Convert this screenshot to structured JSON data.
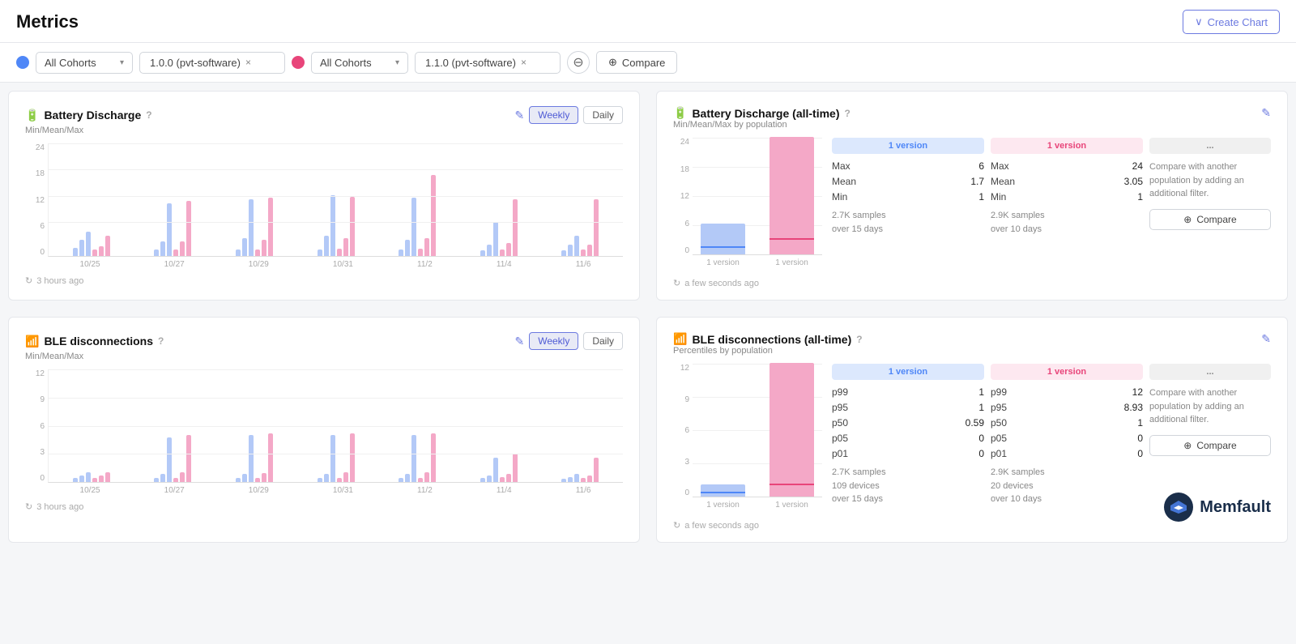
{
  "header": {
    "title": "Metrics",
    "create_chart_label": "Create Chart",
    "create_chart_arrow": "∨"
  },
  "filter_bar": {
    "cohort1_dot": "blue",
    "cohort1_label": "All Cohorts",
    "cohort1_arrow": "▾",
    "version1_label": "1.0.0 (pvt-software)",
    "version1_close": "×",
    "cohort2_label": "All Cohorts",
    "cohort2_arrow": "▾",
    "version2_label": "1.1.0 (pvt-software)",
    "version2_close": "×",
    "remove_icon": "−",
    "compare_icon": "⊕",
    "compare_label": "Compare"
  },
  "battery_discharge": {
    "icon": "🔋",
    "title": "Battery Discharge",
    "subtitle": "Min/Mean/Max",
    "help": "?",
    "weekly_label": "Weekly",
    "daily_label": "Daily",
    "timestamp": "3 hours ago",
    "y_labels": [
      "24",
      "18",
      "12",
      "6",
      "0"
    ],
    "x_labels": [
      "10/25",
      "10/27",
      "10/29",
      "10/31",
      "11/2",
      "11/4",
      "11/6"
    ]
  },
  "battery_discharge_alltime": {
    "icon": "🔋",
    "title": "Battery Discharge (all-time)",
    "subtitle": "Min/Mean/Max by population",
    "help": "?",
    "timestamp": "a few seconds ago",
    "version1_header": "1 version",
    "version2_header": "1 version",
    "compare_header": "...",
    "stats1": {
      "max_label": "Max",
      "max_val": "6",
      "mean_label": "Mean",
      "mean_val": "1.7",
      "min_label": "Min",
      "min_val": "1",
      "samples": "2.7K samples",
      "over": "over 15 days"
    },
    "stats2": {
      "max_label": "Max",
      "max_val": "24",
      "mean_label": "Mean",
      "mean_val": "3.05",
      "min_label": "Min",
      "min_val": "1",
      "samples": "2.9K samples",
      "over": "over 10 days"
    },
    "compare_desc": "Compare with another population by adding an additional filter.",
    "compare_btn": "Compare",
    "x_labels": [
      "1 version",
      "1 version"
    ],
    "y_labels": [
      "24",
      "18",
      "12",
      "6",
      "0"
    ],
    "edit_icon": "✎"
  },
  "ble_disconnections": {
    "icon": "📶",
    "title": "BLE disconnections",
    "subtitle": "Min/Mean/Max",
    "help": "?",
    "weekly_label": "Weekly",
    "daily_label": "Daily",
    "timestamp": "3 hours ago",
    "y_labels": [
      "12",
      "9",
      "6",
      "3",
      "0"
    ],
    "x_labels": [
      "10/25",
      "10/27",
      "10/29",
      "10/31",
      "11/2",
      "11/4",
      "11/6"
    ]
  },
  "ble_disconnections_alltime": {
    "icon": "📶",
    "title": "BLE disconnections (all-time)",
    "subtitle": "Percentiles by population",
    "help": "?",
    "timestamp": "a few seconds ago",
    "version1_header": "1 version",
    "version2_header": "1 version",
    "compare_header": "...",
    "stats1": {
      "p99_label": "p99",
      "p99_val": "1",
      "p95_label": "p95",
      "p95_val": "1",
      "p50_label": "p50",
      "p50_val": "0.59",
      "p05_label": "p05",
      "p05_val": "0",
      "p01_label": "p01",
      "p01_val": "0",
      "samples": "2.7K samples",
      "devices": "109 devices",
      "over": "over 15 days"
    },
    "stats2": {
      "p99_label": "p99",
      "p99_val": "12",
      "p95_label": "p95",
      "p95_val": "8.93",
      "p50_label": "p50",
      "p50_val": "1",
      "p05_label": "p05",
      "p05_val": "0",
      "p01_label": "p01",
      "p01_val": "0",
      "samples": "2.9K samples",
      "devices": "20 devices",
      "over": "over 10 days"
    },
    "compare_desc": "Compare with another population by adding an additional filter.",
    "compare_btn": "Compare",
    "x_labels": [
      "1 version",
      "1 version"
    ],
    "y_labels": [
      "12",
      "9",
      "6",
      "3",
      "0"
    ],
    "edit_icon": "✎"
  },
  "memfault": {
    "logo_text": "Memfault"
  },
  "icons": {
    "refresh": "↻",
    "edit": "✎",
    "chevron_down": "∨",
    "circle_plus": "⊕",
    "circle_minus": "⊖"
  }
}
